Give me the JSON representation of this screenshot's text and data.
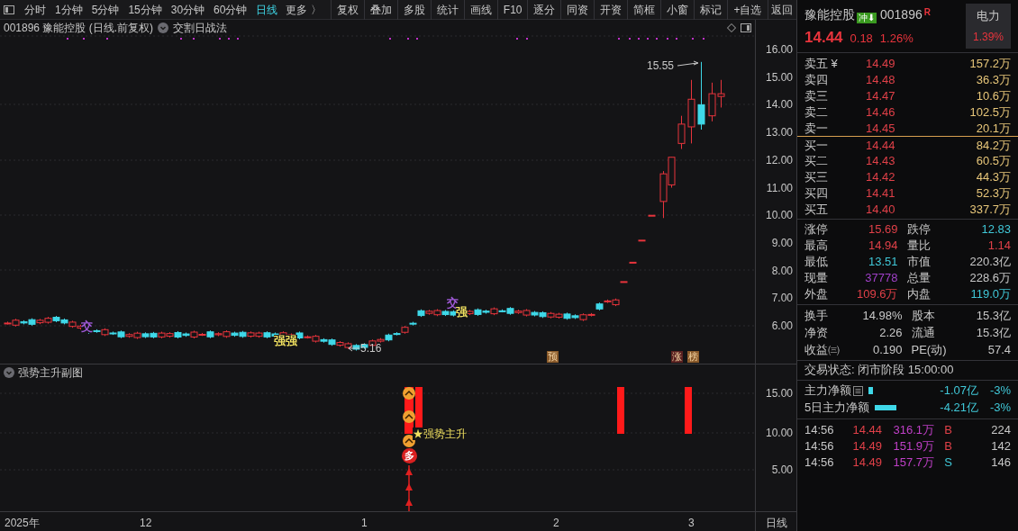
{
  "toolbar": {
    "periods": [
      {
        "label": "分时",
        "selected": false
      },
      {
        "label": "1分钟",
        "selected": false
      },
      {
        "label": "5分钟",
        "selected": false
      },
      {
        "label": "15分钟",
        "selected": false
      },
      {
        "label": "30分钟",
        "selected": false
      },
      {
        "label": "60分钟",
        "selected": false
      },
      {
        "label": "日线",
        "selected": true
      }
    ],
    "more": "更多 〉",
    "buttons": [
      "复权",
      "叠加",
      "多股",
      "统计",
      "画线",
      "F10",
      "逐分",
      "同资",
      "开资",
      "简框",
      "小窗",
      "标记",
      "+自选",
      "返回"
    ]
  },
  "chart_header": {
    "title": "001896 豫能控股 (日线.前复权)",
    "indicator": "交割日战法"
  },
  "main_chart": {
    "y_labels": [
      "16.00",
      "15.00",
      "14.00",
      "13.00",
      "12.00",
      "11.00",
      "10.00",
      "9.00",
      "8.00",
      "7.00",
      "6.00"
    ],
    "high_label": "15.55",
    "low_label": "5.16",
    "markers": [
      {
        "text": "交",
        "kind": "label",
        "color": "#a05ad8"
      },
      {
        "text": "强强",
        "kind": "label",
        "color": "#f0e060"
      },
      {
        "text": "交",
        "kind": "label",
        "color": "#a05ad8"
      },
      {
        "text": "强",
        "kind": "label",
        "color": "#f0e060"
      },
      {
        "text": "预",
        "kind": "tag",
        "color": "#8a5a2a"
      },
      {
        "text": "涨",
        "kind": "tag",
        "color": "#5a2020"
      },
      {
        "text": "榜",
        "kind": "tag",
        "color": "#8a5a2a"
      }
    ]
  },
  "sub_chart": {
    "title": "强势主升副图",
    "y_labels": [
      "15.00",
      "10.00",
      "5.00"
    ],
    "signal": "★强势主升",
    "badge": "多"
  },
  "x_axis": {
    "labels": [
      "2025年",
      "12",
      "1",
      "2",
      "3"
    ],
    "period": "日线"
  },
  "quote": {
    "name": "豫能控股",
    "badge": "冲⬇",
    "code": "001896",
    "flag": "R",
    "sector": "电力",
    "sector_change": "1.39%",
    "price": "14.44",
    "change": "0.18",
    "change_pct": "1.26%"
  },
  "order_book": {
    "asks": [
      {
        "label": "卖五 ¥",
        "price": "14.49",
        "volume": "157.2万"
      },
      {
        "label": "卖四",
        "price": "14.48",
        "volume": "36.3万"
      },
      {
        "label": "卖三",
        "price": "14.47",
        "volume": "10.6万"
      },
      {
        "label": "卖二",
        "price": "14.46",
        "volume": "102.5万"
      },
      {
        "label": "卖一",
        "price": "14.45",
        "volume": "20.1万"
      }
    ],
    "bids": [
      {
        "label": "买一",
        "price": "14.44",
        "volume": "84.2万"
      },
      {
        "label": "买二",
        "price": "14.43",
        "volume": "60.5万"
      },
      {
        "label": "买三",
        "price": "14.42",
        "volume": "44.3万"
      },
      {
        "label": "买四",
        "price": "14.41",
        "volume": "52.3万"
      },
      {
        "label": "买五",
        "price": "14.40",
        "volume": "337.7万"
      }
    ]
  },
  "stats": [
    {
      "label": "涨停",
      "value": "15.69",
      "color": "#e04048"
    },
    {
      "label": "跌停",
      "value": "12.83",
      "color": "#40c8d8"
    },
    {
      "label": "最高",
      "value": "14.94",
      "color": "#e04048"
    },
    {
      "label": "量比",
      "value": "1.14",
      "color": "#e04048"
    },
    {
      "label": "最低",
      "value": "13.51",
      "color": "#40c8d8"
    },
    {
      "label": "市值",
      "value": "220.3亿",
      "color": "#c8c8c8"
    },
    {
      "label": "现量",
      "value": "37778",
      "color": "#a040c8"
    },
    {
      "label": "总量",
      "value": "228.6万",
      "color": "#c8c8c8"
    },
    {
      "label": "外盘",
      "value": "109.6万",
      "color": "#e04048"
    },
    {
      "label": "内盘",
      "value": "119.0万",
      "color": "#40c8d8"
    }
  ],
  "fundamentals": [
    {
      "label": "换手",
      "value": "14.98%"
    },
    {
      "label": "股本",
      "value": "15.3亿"
    },
    {
      "label": "净资",
      "value": "2.26"
    },
    {
      "label": "流通",
      "value": "15.3亿"
    },
    {
      "label": "收益㈢",
      "value": "0.190"
    },
    {
      "label": "PE(动)",
      "value": "57.4"
    }
  ],
  "status": "交易状态: 闭市阶段 15:00:00",
  "flows": [
    {
      "label": "主力净额",
      "value": "-1.07亿",
      "pct": "-3%",
      "kind": "small"
    },
    {
      "label": "5日主力净额",
      "value": "-4.21亿",
      "pct": "-3%",
      "kind": "wide"
    }
  ],
  "ticks": [
    {
      "time": "14:56",
      "price": "14.44",
      "volume": "316.1万",
      "side": "B",
      "count": "224",
      "color": "#e04048"
    },
    {
      "time": "14:56",
      "price": "14.49",
      "volume": "151.9万",
      "side": "B",
      "count": "142",
      "color": "#e04048"
    },
    {
      "time": "14:56",
      "price": "14.49",
      "volume": "157.7万",
      "side": "S",
      "count": "146",
      "color": "#40c8d8"
    }
  ]
}
